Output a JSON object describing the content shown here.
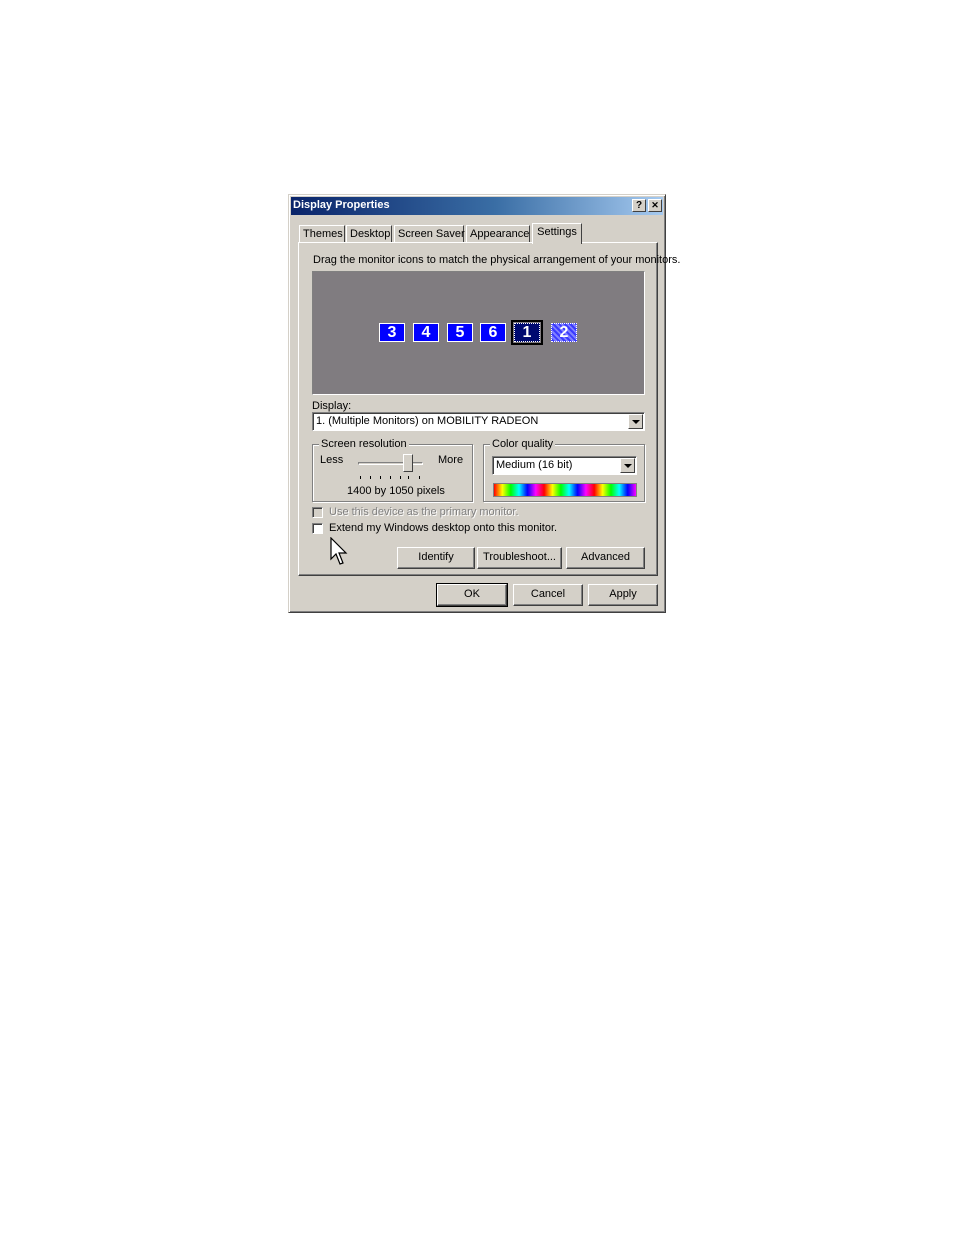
{
  "dialog": {
    "title": "Display Properties",
    "help_label": "?",
    "close_label": "✕"
  },
  "tabs": [
    {
      "label": "Themes"
    },
    {
      "label": "Desktop"
    },
    {
      "label": "Screen Saver"
    },
    {
      "label": "Appearance"
    },
    {
      "label": "Settings",
      "active": true
    }
  ],
  "settings": {
    "instruction": "Drag the monitor icons to match the physical arrangement of your monitors.",
    "monitors": [
      "3",
      "4",
      "5",
      "6",
      "1",
      "2"
    ],
    "selected_monitor": "1",
    "display_label": "Display:",
    "display_value": "1. (Multiple Monitors) on MOBILITY RADEON",
    "screen_resolution": {
      "legend": "Screen resolution",
      "less_label": "Less",
      "more_label": "More",
      "value_text": "1400 by 1050 pixels"
    },
    "color_quality": {
      "legend": "Color quality",
      "value": "Medium (16 bit)"
    },
    "primary_checkbox": {
      "label": "Use this device as the primary monitor.",
      "checked": false,
      "enabled": false
    },
    "extend_checkbox": {
      "label": "Extend my Windows desktop onto this monitor.",
      "checked": false,
      "enabled": true
    },
    "identify_label": "Identify",
    "troubleshoot_label": "Troubleshoot...",
    "advanced_label": "Advanced"
  },
  "footer": {
    "ok_label": "OK",
    "cancel_label": "Cancel",
    "apply_label": "Apply"
  },
  "colors": {
    "titlebar_start": "#0a246a",
    "titlebar_end": "#a6caf0",
    "window_face": "#d4d0c8",
    "monitor_bg": "#807c80",
    "monitor_icon": "#0000ff"
  }
}
